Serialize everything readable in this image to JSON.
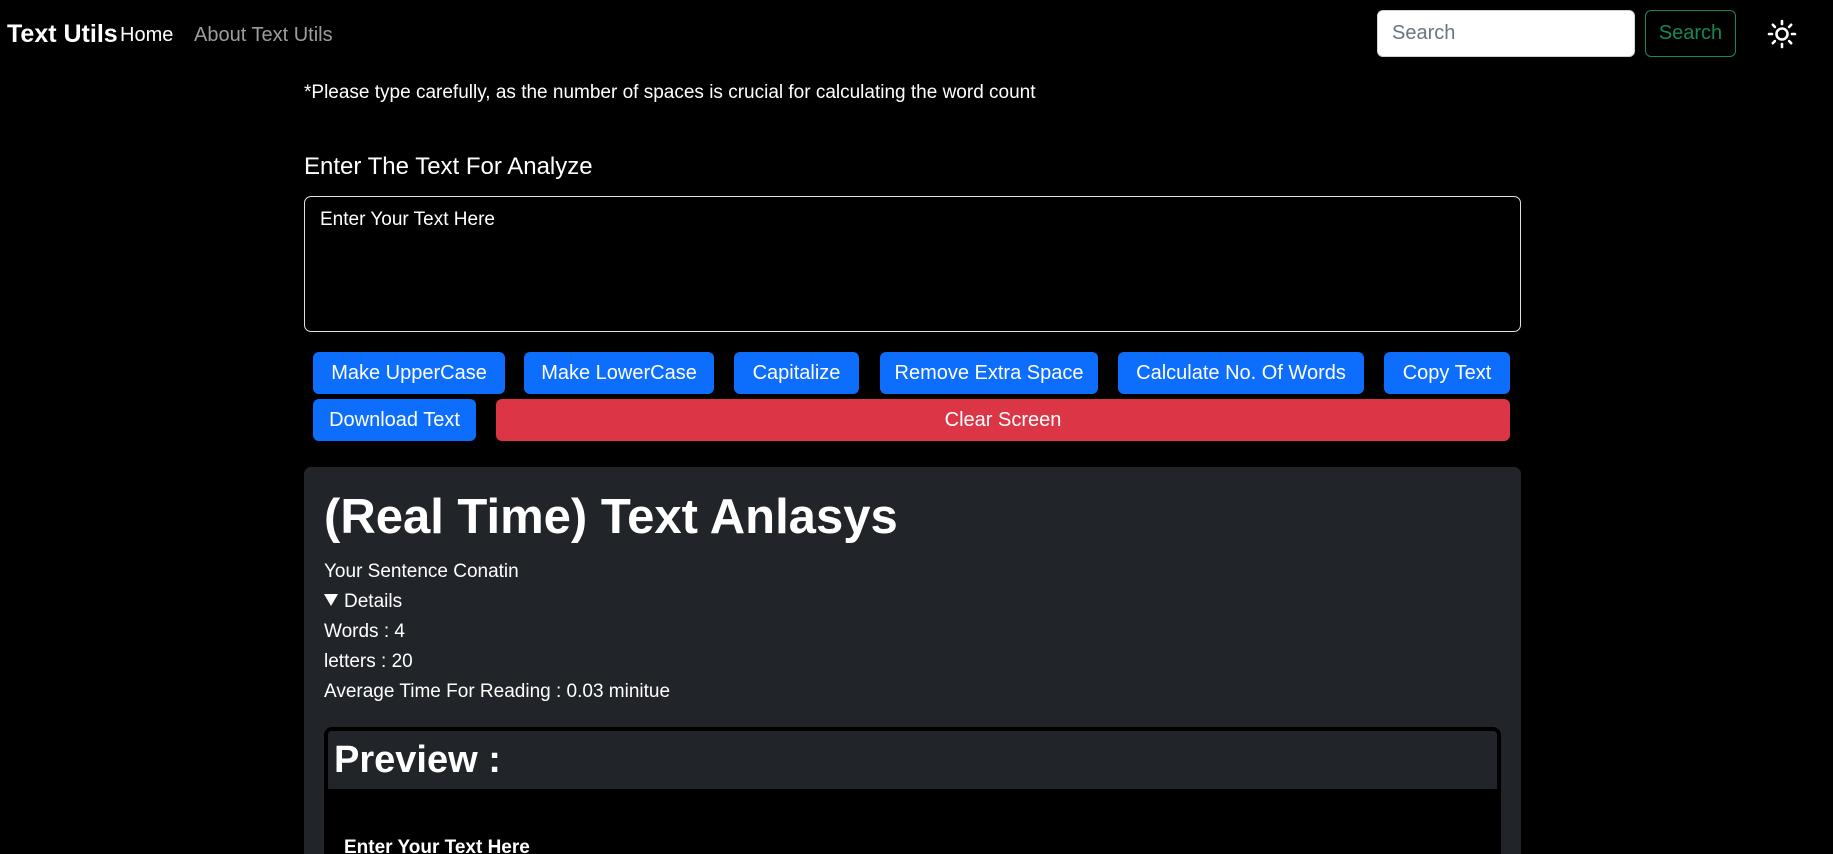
{
  "navbar": {
    "brand": "Text Utils",
    "links": [
      "Home",
      "About Text Utils"
    ],
    "search_placeholder": "Search",
    "search_button": "Search",
    "theme_icon": "sun-icon"
  },
  "notice": "*Please type carefully, as the number of spaces is crucial for calculating the word count",
  "form": {
    "label": "Enter The Text For Analyze",
    "textarea_placeholder": "Enter Your Text Here",
    "textarea_value": ""
  },
  "buttons": {
    "uppercase": "Make UpperCase",
    "lowercase": "Make LowerCase",
    "capitalize": "Capitalize",
    "remove_space": "Remove Extra Space",
    "word_count": "Calculate No. Of Words",
    "copy": "Copy Text",
    "download": "Download Text",
    "clear": "Clear Screen"
  },
  "analysis": {
    "title": "(Real Time) Text Anlasys",
    "subtitle": "Your Sentence Conatin",
    "details_label": "Details",
    "words": "Words : 4",
    "letters": "letters : 20",
    "reading_time": "Average Time For Reading : 0.03 minitue"
  },
  "preview": {
    "title": "Preview :",
    "text": "Enter Your Text Here"
  },
  "colors": {
    "background": "#000000",
    "primary": "#0d6efd",
    "danger": "#dc3545",
    "success": "#198754",
    "card": "#212529"
  }
}
